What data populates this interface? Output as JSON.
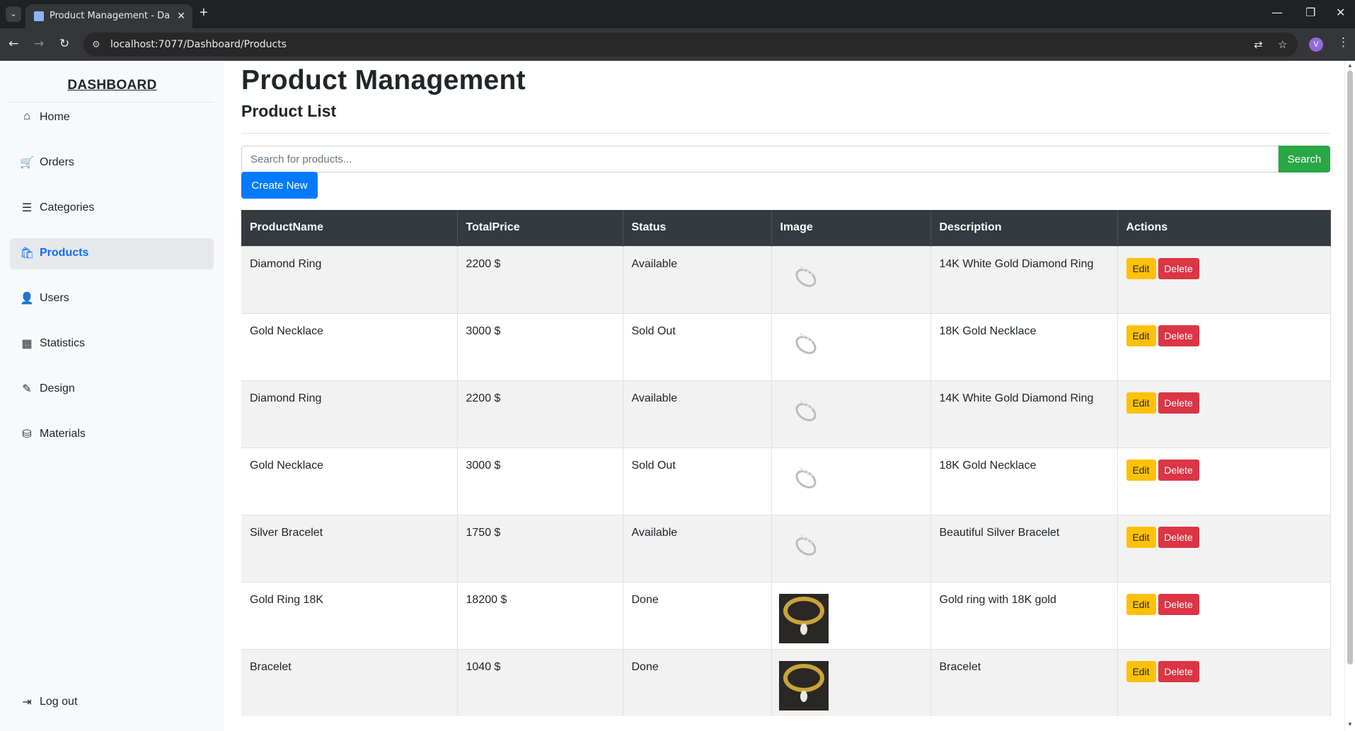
{
  "browser": {
    "tab_title": "Product Management - Dashbo",
    "url": "localhost:7077/Dashboard/Products",
    "profile_initial": "V"
  },
  "sidebar": {
    "brand": "DASHBOARD",
    "items": [
      {
        "label": "Home",
        "icon": "home-icon",
        "glyph": "⌂"
      },
      {
        "label": "Orders",
        "icon": "cart-icon",
        "glyph": "🛒"
      },
      {
        "label": "Categories",
        "icon": "list-icon",
        "glyph": "☰"
      },
      {
        "label": "Products",
        "icon": "bag-icon",
        "glyph": "🛍"
      },
      {
        "label": "Users",
        "icon": "user-icon",
        "glyph": "👤"
      },
      {
        "label": "Statistics",
        "icon": "chart-icon",
        "glyph": "▦"
      },
      {
        "label": "Design",
        "icon": "brush-icon",
        "glyph": "✎"
      },
      {
        "label": "Materials",
        "icon": "database-icon",
        "glyph": "⛁"
      }
    ],
    "logout": {
      "label": "Log out",
      "icon": "logout-icon",
      "glyph": "⇥"
    }
  },
  "main": {
    "title": "Product Management",
    "subtitle": "Product List",
    "search_placeholder": "Search for products...",
    "search_button": "Search",
    "create_button": "Create New",
    "table": {
      "columns": [
        "ProductName",
        "TotalPrice",
        "Status",
        "Image",
        "Description",
        "Actions"
      ],
      "rows": [
        {
          "name": "Diamond Ring",
          "price": "2200 $",
          "status": "Available",
          "image": "ring",
          "description": "14K White Gold Diamond Ring"
        },
        {
          "name": "Gold Necklace",
          "price": "3000 $",
          "status": "Sold Out",
          "image": "ring",
          "description": "18K Gold Necklace"
        },
        {
          "name": "Diamond Ring",
          "price": "2200 $",
          "status": "Available",
          "image": "ring",
          "description": "14K White Gold Diamond Ring"
        },
        {
          "name": "Gold Necklace",
          "price": "3000 $",
          "status": "Sold Out",
          "image": "ring",
          "description": "18K Gold Necklace"
        },
        {
          "name": "Silver Bracelet",
          "price": "1750 $",
          "status": "Available",
          "image": "ring",
          "description": "Beautiful Silver Bracelet"
        },
        {
          "name": "Gold Ring 18K",
          "price": "18200 $",
          "status": "Done",
          "image": "photo",
          "description": "Gold ring with 18K gold"
        },
        {
          "name": "Bracelet",
          "price": "1040 $",
          "status": "Done",
          "image": "photo",
          "description": "Bracelet"
        }
      ],
      "edit_label": "Edit",
      "delete_label": "Delete"
    }
  }
}
